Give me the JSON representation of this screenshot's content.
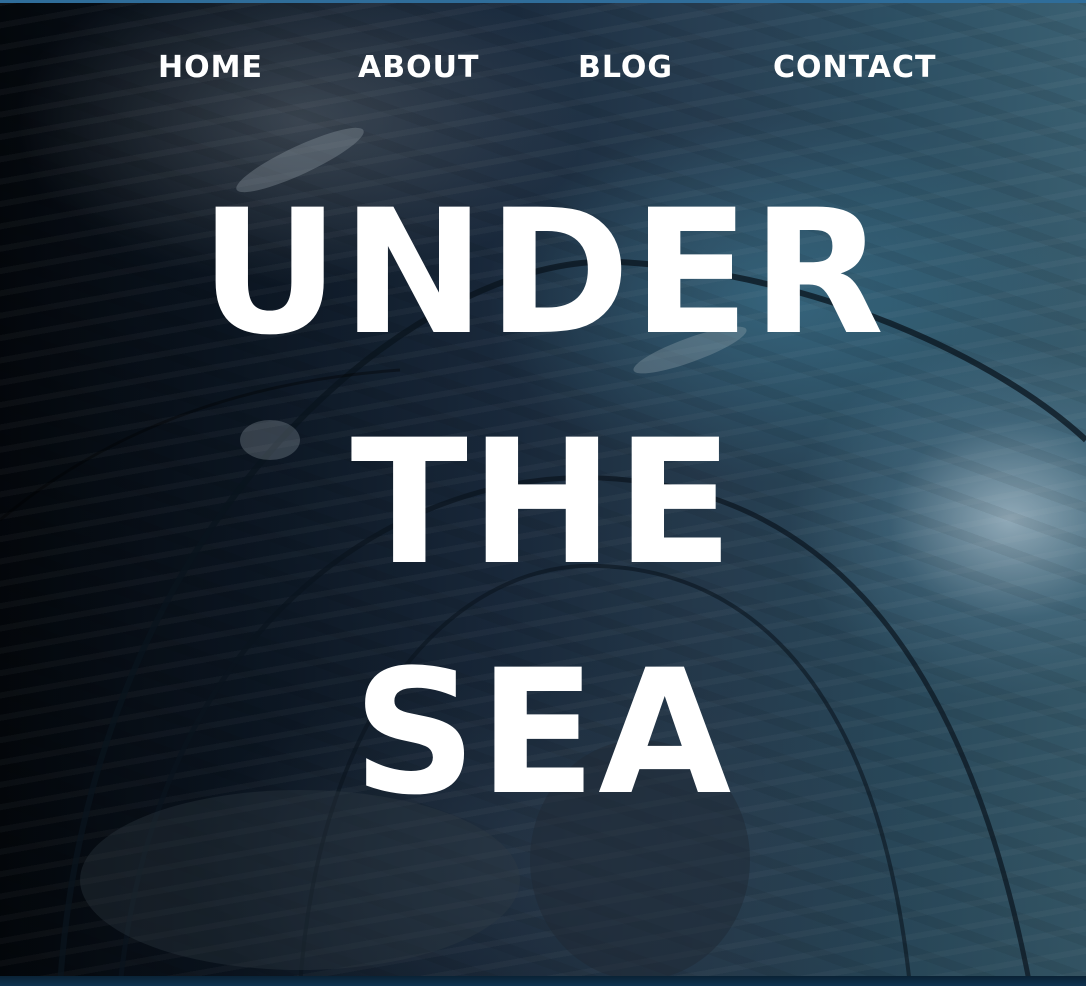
{
  "nav": {
    "items": [
      {
        "label": "HOME"
      },
      {
        "label": "ABOUT"
      },
      {
        "label": "BLOG"
      },
      {
        "label": "CONTACT"
      }
    ]
  },
  "hero": {
    "title_lines": [
      "UNDER",
      "THE",
      "SEA"
    ],
    "background_image": "underwater-tunnel-photo"
  },
  "colors": {
    "text": "#ffffff",
    "accent_top_edge": "#2f6d9a"
  }
}
